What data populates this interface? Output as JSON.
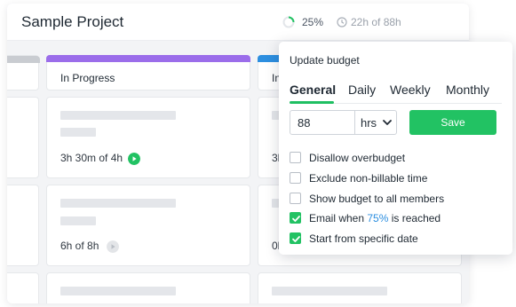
{
  "project": {
    "title": "Sample Project",
    "progress_percent": 25,
    "progress_label": "25%",
    "budget_summary": "22h of 88h"
  },
  "columns": [
    {
      "title": "",
      "color": "#c9ccd1"
    },
    {
      "title": "In Progress",
      "color": "#9b6dea"
    },
    {
      "title": "In",
      "color": "#2d8fe0"
    }
  ],
  "tasks": {
    "col2_row1": {
      "time": "3h 30m of 4h",
      "timer_active": true
    },
    "col2_row2": {
      "time": "6h of 8h",
      "timer_active": false
    },
    "col3_row1": {
      "time": "3h"
    },
    "col3_row2": {
      "time": "0h"
    }
  },
  "popover": {
    "title": "Update budget",
    "tabs": [
      {
        "label": "General",
        "active": true
      },
      {
        "label": "Daily",
        "active": false
      },
      {
        "label": "Weekly",
        "active": false
      },
      {
        "label": "Monthly",
        "active": false
      }
    ],
    "budget_value": "88",
    "unit": "hrs",
    "save_label": "Save",
    "options": [
      {
        "label": "Disallow overbudget",
        "checked": false
      },
      {
        "label": "Exclude non-billable time",
        "checked": false
      },
      {
        "label": "Show budget to all members",
        "checked": false
      },
      {
        "label_before": "Email when ",
        "label_accent": "75%",
        "label_after": " is reached",
        "checked": true
      },
      {
        "label": "Start from specific date",
        "checked": true
      }
    ]
  },
  "colors": {
    "accent_green": "#22c263",
    "link_blue": "#2d8fe0",
    "purple": "#9b6dea",
    "blue": "#2d8fe0"
  },
  "icons": {
    "progress": "progress-ring-icon",
    "clock": "clock-icon",
    "play": "play-icon",
    "chevron": "chevron-down-icon",
    "check": "check-icon"
  }
}
